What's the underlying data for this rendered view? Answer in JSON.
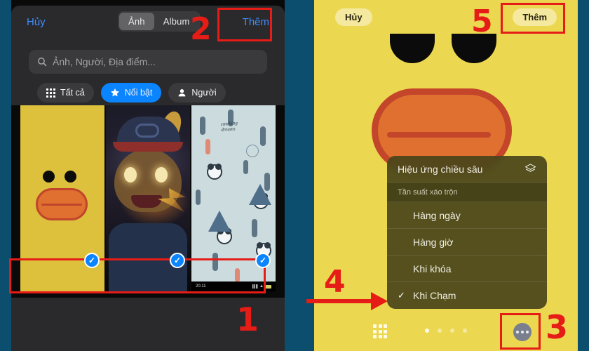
{
  "background_color": "#0b4e6e",
  "left_panel": {
    "name": "ios-photo-picker",
    "topbar": {
      "cancel_label": "Hủy",
      "add_label": "Thêm",
      "segments": [
        {
          "label": "Ảnh",
          "selected": true
        },
        {
          "label": "Album",
          "selected": false
        }
      ]
    },
    "search": {
      "placeholder": "Ảnh, Người, Địa điểm...",
      "value": "",
      "icon": "search-icon"
    },
    "filter_chips": [
      {
        "label": "Tất cả",
        "icon": "grid-icon",
        "active": false
      },
      {
        "label": "Nổi bật",
        "icon": "star-icon",
        "active": true
      },
      {
        "label": "Người",
        "icon": "person-icon",
        "active": false
      }
    ],
    "photos": [
      {
        "name": "yellow-duck-wallpaper",
        "selected": true
      },
      {
        "name": "pokemon-detective-pikachu-wallpaper",
        "selected": true
      },
      {
        "name": "panda-cactus-pattern-wallpaper",
        "selected": true
      }
    ],
    "thumbnail_status_bar": {
      "time": "20:11"
    },
    "selection_check_glyph": "✓"
  },
  "right_panel": {
    "name": "ios-lock-screen-wallpaper-editor",
    "topbar": {
      "cancel_label": "Hủy",
      "add_label": "Thêm"
    },
    "wallpaper": "yellow-duck-wallpaper",
    "context_menu": {
      "depth_effect": {
        "label": "Hiệu ứng chiều sâu",
        "icon": "layers-icon"
      },
      "section_header": "Tần suất xáo trộn",
      "options": [
        {
          "label": "Hàng ngày",
          "checked": false
        },
        {
          "label": "Hàng giờ",
          "checked": false
        },
        {
          "label": "Khi khóa",
          "checked": false
        },
        {
          "label": "Khi Chạm",
          "checked": true
        }
      ],
      "check_glyph": "✓"
    },
    "bottom_bar": {
      "grid_icon": "grid-9-icon",
      "page_dots": {
        "count": 4,
        "active_index": 0
      },
      "more_button": "more-ellipsis-icon"
    }
  },
  "annotations": {
    "color": "#e61c17",
    "markers": [
      {
        "number": "1",
        "target": "selected-photo-row"
      },
      {
        "number": "2",
        "target": "left-add-button"
      },
      {
        "number": "3",
        "target": "more-ellipsis-button"
      },
      {
        "number": "4",
        "target": "khi-cham-option"
      },
      {
        "number": "5",
        "target": "right-add-button"
      }
    ]
  }
}
